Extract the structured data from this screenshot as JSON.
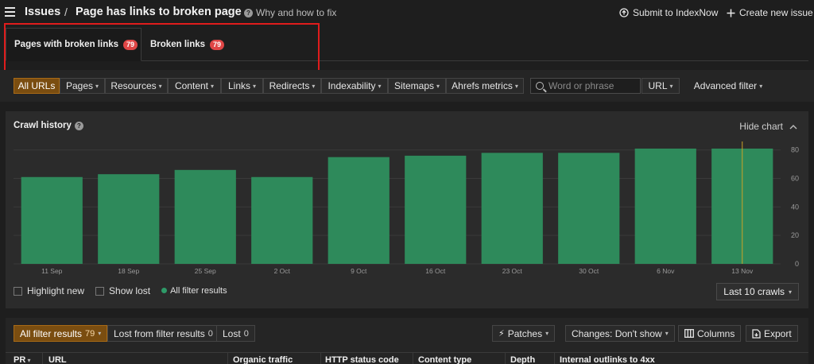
{
  "breadcrumb": {
    "root": "Issues",
    "separator": "/",
    "page": "Page has links to broken page"
  },
  "help_link": "Why and how to fix",
  "top_actions": {
    "submit": "Submit to IndexNow",
    "create": "Create new issue"
  },
  "tabs": [
    {
      "label": "Pages with broken links",
      "count": "79",
      "active": true
    },
    {
      "label": "Broken links",
      "count": "79",
      "active": false
    }
  ],
  "filters": [
    "All URLs",
    "Pages",
    "Resources",
    "Content",
    "Links",
    "Redirects",
    "Indexability",
    "Sitemaps",
    "Ahrefs metrics"
  ],
  "search": {
    "placeholder": "Word or phrase",
    "scope": "URL"
  },
  "advanced_filter": "Advanced filter",
  "crawl_history": {
    "title": "Crawl history",
    "hide_label": "Hide chart",
    "highlight_new": "Highlight new",
    "show_lost": "Show lost",
    "all_filter_results": "All filter results",
    "last_crawls": "Last 10 crawls"
  },
  "chart_data": {
    "type": "bar",
    "categories": [
      "11 Sep",
      "18 Sep",
      "25 Sep",
      "2 Oct",
      "9 Oct",
      "16 Oct",
      "23 Oct",
      "30 Oct",
      "6 Nov",
      "13 Nov"
    ],
    "values": [
      61,
      63,
      66,
      61,
      75,
      76,
      78,
      78,
      81,
      81
    ],
    "yticks": [
      0,
      20,
      40,
      60,
      80
    ],
    "ylim": [
      0,
      86
    ],
    "grid": true,
    "bar_color": "#2e8a5b",
    "highlight_color": "#c9a227"
  },
  "results_bar": {
    "all_filter_results": "All filter results",
    "all_count": "79",
    "lost_from_filter": "Lost from filter results",
    "lost_from_filter_count": "0",
    "lost": "Lost",
    "lost_count": "0",
    "patches": "Patches",
    "changes": "Changes: Don't show",
    "columns": "Columns",
    "export": "Export"
  },
  "table_headers": [
    "PR",
    "URL",
    "Organic traffic",
    "HTTP status code",
    "Content type",
    "Depth",
    "Internal outlinks to 4xx"
  ]
}
